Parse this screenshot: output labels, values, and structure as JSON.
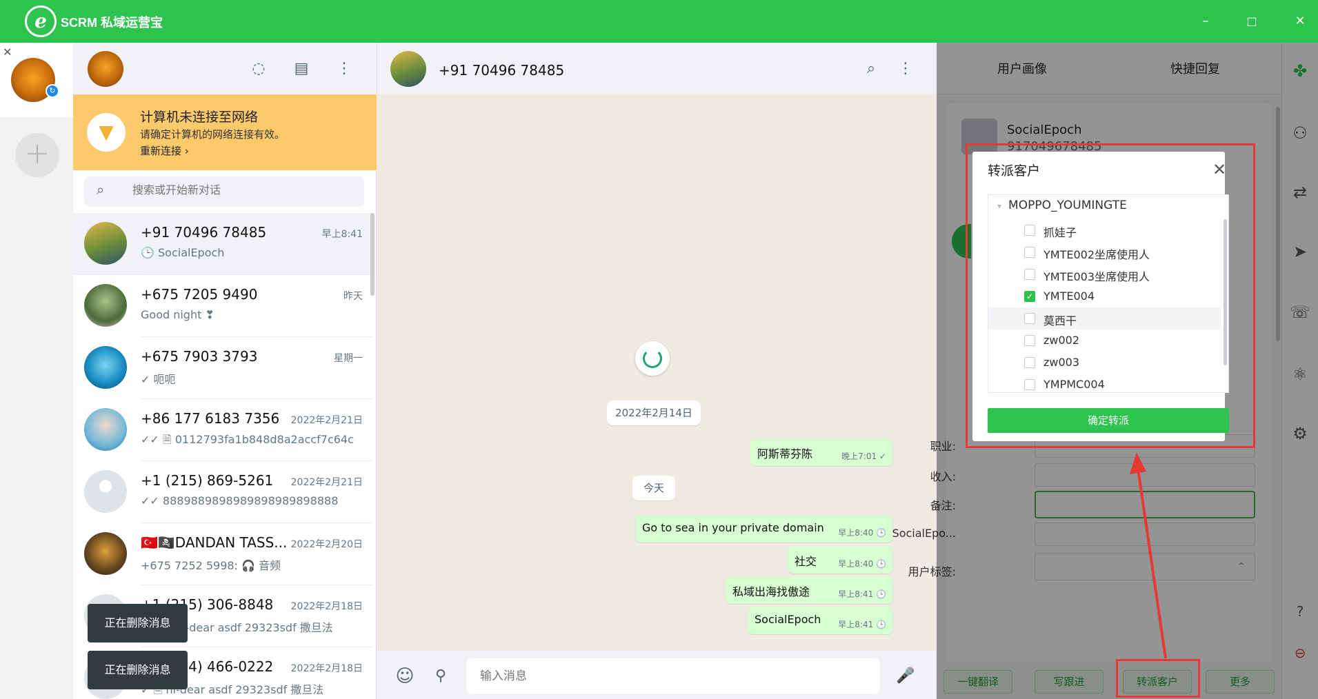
{
  "app": {
    "logo_glyph": "e",
    "title": "SCRM 私域运营宝",
    "minimize": "–",
    "maximize": "□",
    "close": "✕",
    "accent": "#2ec24f"
  },
  "accounts": {
    "close_glyph": "✕",
    "add_glyph": "+"
  },
  "list": {
    "banner": {
      "title": "计算机未连接至网络",
      "desc": "请确定计算机的网络连接有效。",
      "link": "重新连接 ›"
    },
    "search_placeholder": "搜索或开始新对话",
    "chats": [
      {
        "name": "+91 70496 78485",
        "time": "早上8:41",
        "preview": "🕒 SocialEpoch"
      },
      {
        "name": "+675 7205 9490",
        "time": "昨天",
        "preview": "Good night ❣"
      },
      {
        "name": "+675 7903 3793",
        "time": "星期一",
        "preview": "✓ 呃呃"
      },
      {
        "name": "+86 177 6183 7356",
        "time": "2022年2月21日",
        "preview": "✓✓ 🗎 0112793fa1b848d8a2accf7c64cc..."
      },
      {
        "name": "+1 (215) 869-5261",
        "time": "2022年2月21日",
        "preview": "✓✓ 8889889898989898989898888"
      },
      {
        "name": "🇹🇷🏴‍☠️DANDAN TASS...",
        "time": "2022年2月20日",
        "preview": "+675 7252 5998: 🎧 音频"
      },
      {
        "name": "+1 (215) 306-8848",
        "time": "2022年2月18日",
        "preview": "✓✓ 🗎 hi-dear asdf 29323sdf 撒旦法"
      },
      {
        "name": "+1 (214) 466-0222",
        "time": "2022年2月18日",
        "preview": "✓ 🗎 hi-dear asdf 29323sdf 撒旦法"
      }
    ],
    "toast": "正在删除消息"
  },
  "conversation": {
    "title": "+91 70496 78485",
    "date_pill": "2022年2月14日",
    "today_pill": "今天",
    "messages": [
      {
        "text": "阿斯蒂芬陈",
        "time": "晚上7:01 ✓"
      },
      {
        "text": "Go to sea in your private domain",
        "time": "早上8:40 🕒"
      },
      {
        "text": "社交",
        "time": "早上8:40 🕒"
      },
      {
        "text": "私域出海找傲途",
        "time": "早上8:41 🕒"
      },
      {
        "text": "SocialEpoch",
        "time": "早上8:41 🕒"
      }
    ],
    "input_placeholder": "输入消息"
  },
  "right_panel": {
    "tab_profile": "用户画像",
    "tab_quick_reply": "快捷回复",
    "user_name": "SocialEpoch",
    "user_number": "917049678485",
    "labels": {
      "job": "职业:",
      "income": "收入:",
      "note": "备注:",
      "socialepoch": "SocialEpo...",
      "tags": "用户标签:"
    },
    "buttons": {
      "translate": "一键翻译",
      "follow": "写跟进",
      "transfer": "转派客户",
      "more": "更多"
    }
  },
  "dialog": {
    "title": "转派客户",
    "root": "MOPPO_YOUMINGTE",
    "items": [
      {
        "label": "抓娃子",
        "checked": false
      },
      {
        "label": "YMTE002坐席使用人",
        "checked": false
      },
      {
        "label": "YMTE003坐席使用人",
        "checked": false
      },
      {
        "label": "YMTE004",
        "checked": true
      },
      {
        "label": "莫西干",
        "checked": false
      },
      {
        "label": "zw002",
        "checked": false
      },
      {
        "label": "zw003",
        "checked": false
      },
      {
        "label": "YMPMC004",
        "checked": false
      }
    ],
    "confirm": "确定转派"
  }
}
